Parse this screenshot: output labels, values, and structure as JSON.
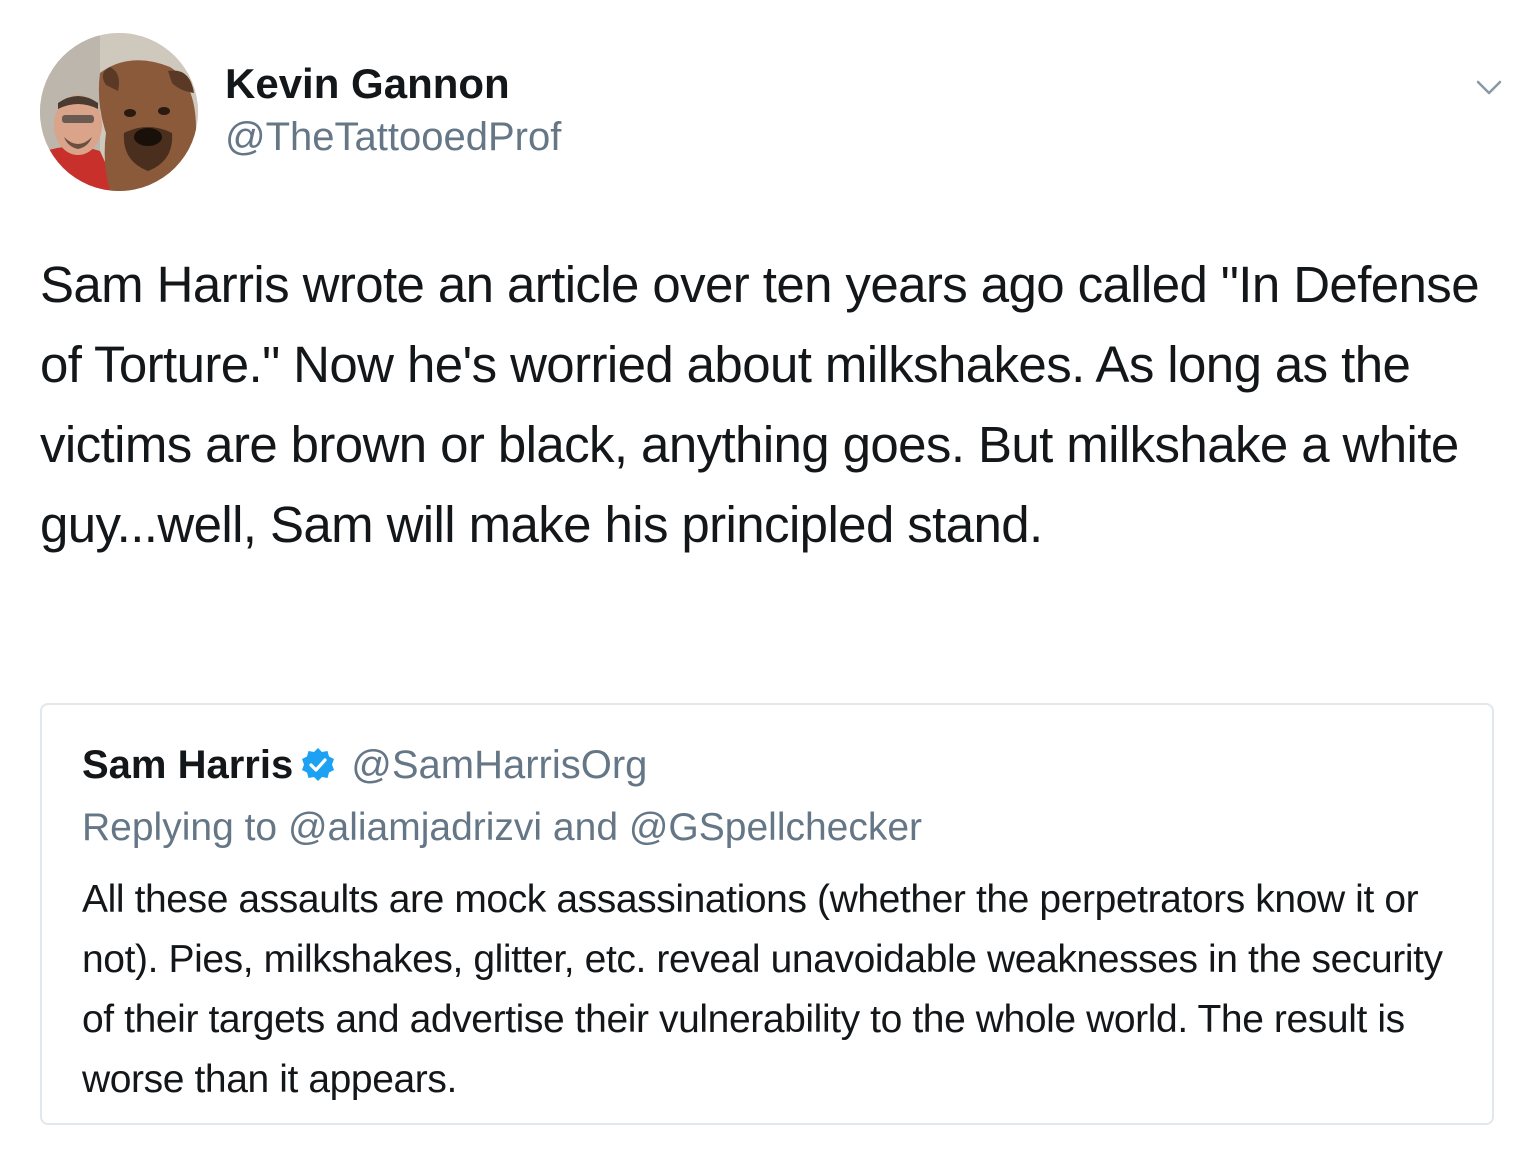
{
  "author": {
    "display_name": "Kevin Gannon",
    "handle": "@TheTattooedProf",
    "avatar_icon": "avatar-photo-man-with-dog"
  },
  "menu_icon": "chevron-down-icon",
  "tweet": {
    "text": "Sam Harris wrote an article over ten years ago called \"In Defense of Torture.\" Now he's worried about milkshakes. As long as the victims are brown or black, anything goes. But milkshake a white guy...well, Sam will make his principled stand."
  },
  "quoted_tweet": {
    "display_name": "Sam Harris",
    "verified_icon": "verified-badge-icon",
    "handle": "@SamHarrisOrg",
    "replying_to": "Replying to @aliamjadrizvi and @GSpellchecker",
    "text": "All these assaults are mock assassinations (whether the perpetrators know it or not). Pies, milkshakes, glitter, etc. reveal unavoidable weaknesses in the security of their targets and advertise their vulnerability to the whole world. The result is worse than it appears."
  },
  "colors": {
    "text_primary": "#14171a",
    "text_secondary": "#657786",
    "verified_blue": "#1da1f2",
    "border": "#e1e8ed"
  }
}
